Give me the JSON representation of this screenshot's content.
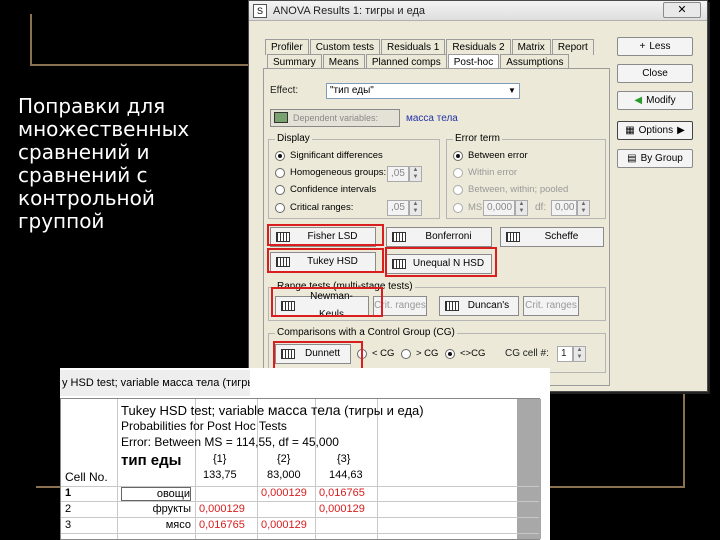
{
  "slide": {
    "text": "Поправки для множественных сравнений и сравнений с контрольной группой"
  },
  "window": {
    "title": "ANOVA Results 1: тигры и еда",
    "close_label": "✕",
    "tabs_row1": [
      "Profiler",
      "Custom tests",
      "Residuals 1",
      "Residuals 2",
      "Matrix",
      "Report"
    ],
    "tabs_row2": [
      "Summary",
      "Means",
      "Planned comps",
      "Post-hoc",
      "Assumptions"
    ],
    "active_tab": "Post-hoc",
    "effect_label": "Effect:",
    "effect_value": "\"тип еды\"",
    "dependent_button": "Dependent variables:",
    "dependent_value": "масса тела",
    "display": {
      "title": "Display",
      "options": [
        "Significant differences",
        "Homogeneous groups:",
        "Confidence intervals",
        "Critical ranges:"
      ],
      "selected": 0,
      "homogeneous_value": ",05",
      "critical_value": ",05"
    },
    "error_term": {
      "title": "Error term",
      "options": [
        "Between error",
        "Within error",
        "Between, within; pooled",
        "MS:"
      ],
      "selected": 0,
      "ms_value": "0,000",
      "df_label": "df:",
      "df_value": "0,00"
    },
    "tests_row1": [
      "Fisher LSD",
      "Bonferroni",
      "Scheffe"
    ],
    "tests_row2": [
      "Tukey HSD",
      "Unequal N HSD"
    ],
    "range_tests": {
      "title": "Range tests (multi-stage tests)",
      "buttons": [
        "Newman-Keuls",
        "Crit. ranges",
        "Duncan's",
        "Crit. ranges"
      ]
    },
    "control_group": {
      "title": "Comparisons with a Control Group (CG)",
      "dunnett": "Dunnett",
      "options": [
        "< CG",
        "> CG",
        "<>CG"
      ],
      "selected": 2,
      "cg_label": "CG cell #:",
      "cg_value": "1"
    },
    "side_buttons": [
      "Less",
      "Close",
      "Modify",
      "Options",
      "By Group"
    ]
  },
  "results": {
    "window_title": "y HSD test; variable масса тела (тигры",
    "header_line1_prefix": "Tukey HSD test; variable",
    "header_line1_var": "масса тела",
    "header_line1_suffix": "(тигры и еда)",
    "header_line2": "Probabilities for Post Hoc Tests",
    "header_line3": "Error: Between MS = 114,55, df = 45,000",
    "cell_no": "Cell No.",
    "factor": "тип еды",
    "col_labels": [
      "{1}",
      "{2}",
      "{3}"
    ],
    "col_means": [
      "133,75",
      "83,000",
      "144,63"
    ],
    "rows": [
      {
        "no": "1",
        "name": "овощи",
        "values": [
          "",
          "0,000129",
          "0,016765"
        ]
      },
      {
        "no": "2",
        "name": "фрукты",
        "values": [
          "0,000129",
          "",
          "0,000129"
        ]
      },
      {
        "no": "3",
        "name": "мясо",
        "values": [
          "0,016765",
          "0,000129",
          ""
        ]
      }
    ]
  },
  "colors": {
    "highlight": "#d81e1e",
    "background": "#000000",
    "accent_line": "#8a7250"
  }
}
